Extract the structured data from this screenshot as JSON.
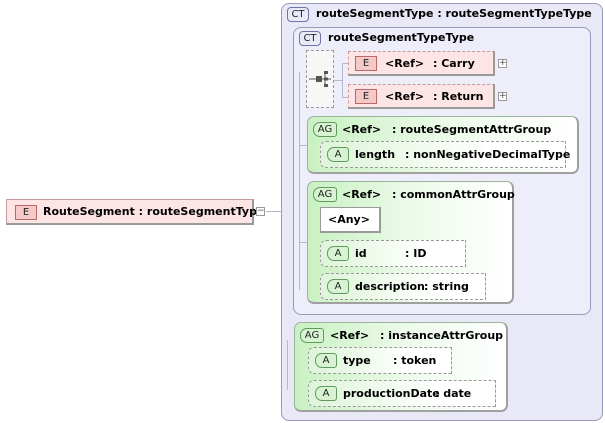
{
  "root_element": {
    "badge": "E",
    "label": "RouteSegment : routeSegmentType",
    "collapse": "−"
  },
  "outer_type": {
    "badge": "CT",
    "label": "routeSegmentType : routeSegmentTypeType"
  },
  "inner_type": {
    "badge": "CT",
    "label": "routeSegmentTypeType"
  },
  "sequence_elements": [
    {
      "badge": "E",
      "ref": "<Ref>",
      "type": ": Carry",
      "expand": "+"
    },
    {
      "badge": "E",
      "ref": "<Ref>",
      "type": ": Return",
      "expand": "+"
    }
  ],
  "groups": [
    {
      "badge": "AG",
      "ref": "<Ref>",
      "name": ": routeSegmentAttrGroup",
      "attributes": [
        {
          "badge": "A",
          "name": "length",
          "type": ": nonNegativeDecimalType"
        }
      ]
    },
    {
      "badge": "AG",
      "ref": "<Ref>",
      "name": ": commonAttrGroup",
      "any": "<Any>",
      "attributes": [
        {
          "badge": "A",
          "name": "id",
          "type": ": ID"
        },
        {
          "badge": "A",
          "name": "description",
          "type": ": string"
        }
      ]
    },
    {
      "badge": "AG",
      "ref": "<Ref>",
      "name": ": instanceAttrGroup",
      "attributes": [
        {
          "badge": "A",
          "name": "type",
          "type": ": token"
        },
        {
          "badge": "A",
          "name": "productionDate",
          "type": ": date"
        }
      ]
    }
  ]
}
